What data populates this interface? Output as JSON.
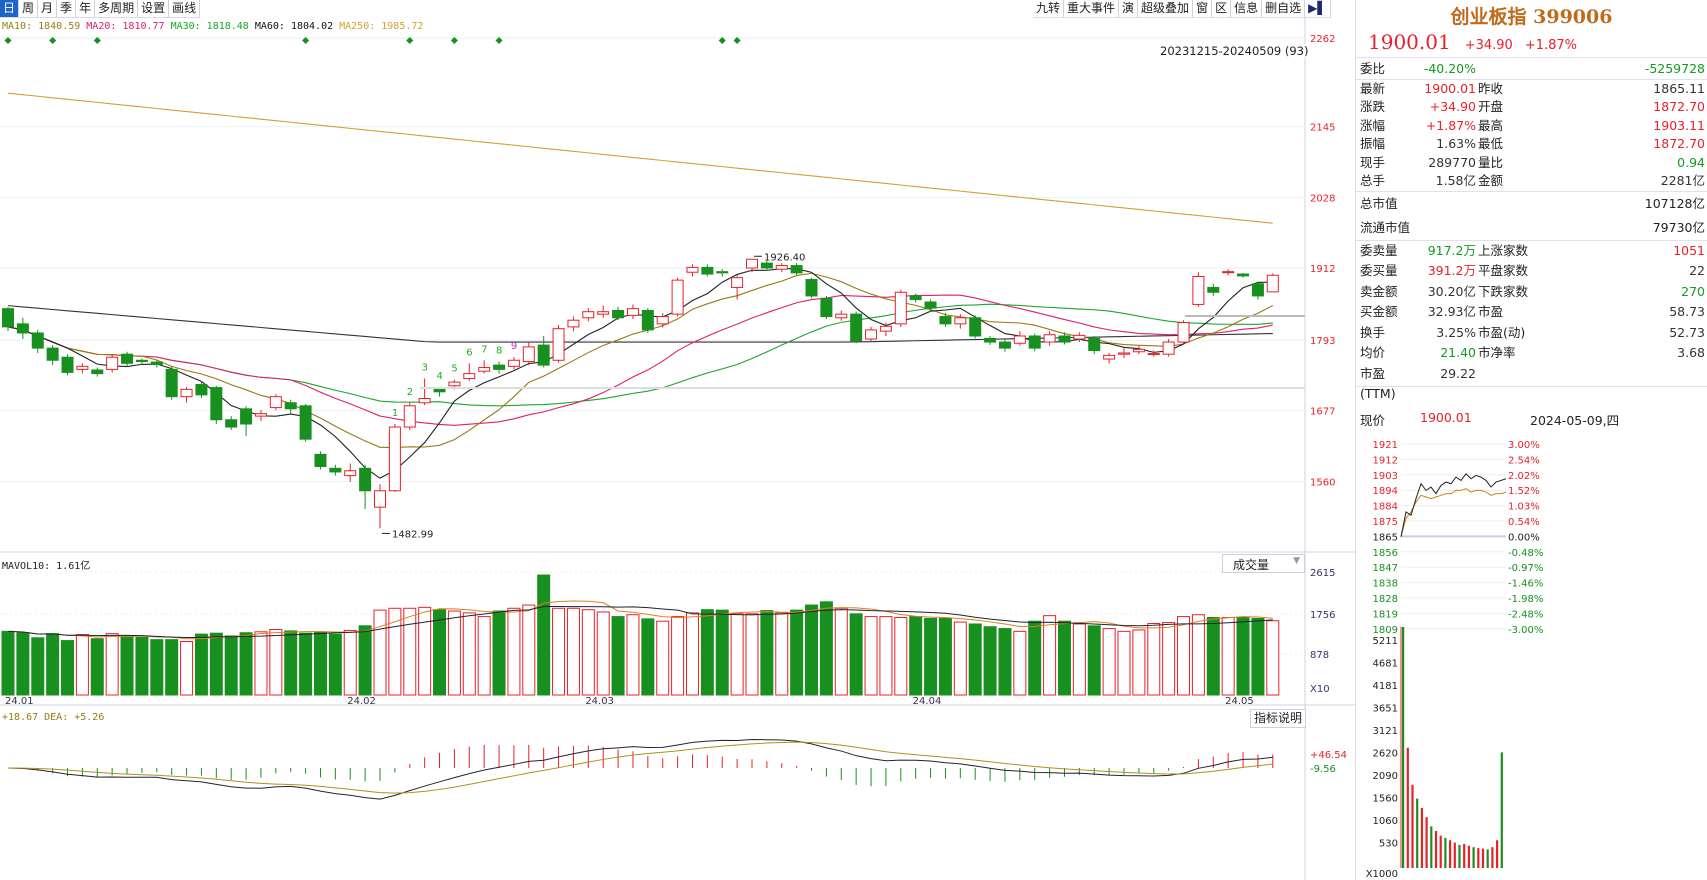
{
  "toolbar_left": [
    "日",
    "周",
    "月",
    "季",
    "年",
    "多周期",
    "设置",
    "画线"
  ],
  "toolbar_right": [
    "九转",
    "重大事件",
    "演",
    "超级叠加",
    "窗",
    "区",
    "信息",
    "删自选"
  ],
  "ma_legend": [
    {
      "t": "MA10: 1840.59",
      "c": "#9a7a14"
    },
    {
      "t": "MA20: 1810.77",
      "c": "#e0206a"
    },
    {
      "t": "MA30: 1818.48",
      "c": "#1aa62a"
    },
    {
      "t": "MA60: 1804.02",
      "c": "#111111"
    },
    {
      "t": "MA250: 1985.72",
      "c": "#d4a030"
    }
  ],
  "range_label": "20231215-20240509 (93)",
  "vol_label": "MAVOL10: 1.61亿",
  "vol_select": "成交量",
  "macd_label": "+18.67 DEA: +5.26",
  "macd_btn": "指标说明",
  "chart_data": {
    "type": "candlestick",
    "price_ticks": [
      "2262",
      "2145",
      "2028",
      "1912",
      "1793",
      "1677",
      "1560"
    ],
    "price_tick_values": [
      2262,
      2145,
      2028,
      1912,
      1793,
      1677,
      1560
    ],
    "vol_ticks": [
      "2615",
      "1756",
      "878",
      "X10"
    ],
    "macd_ticks": [
      "+46.54",
      "-9.56"
    ],
    "date_labels": [
      {
        "t": "24.01",
        "i": 0
      },
      {
        "t": "24.02",
        "i": 23
      },
      {
        "t": "24.03",
        "i": 39
      },
      {
        "t": "24.04",
        "i": 61
      },
      {
        "t": "24.05",
        "i": 82
      }
    ],
    "ohlc": [
      [
        1845,
        1815,
        1848,
        1808
      ],
      [
        1820,
        1805,
        1830,
        1795
      ],
      [
        1805,
        1780,
        1810,
        1772
      ],
      [
        1780,
        1760,
        1785,
        1752
      ],
      [
        1765,
        1740,
        1770,
        1735
      ],
      [
        1745,
        1750,
        1755,
        1738
      ],
      [
        1744,
        1738,
        1748,
        1733
      ],
      [
        1745,
        1765,
        1770,
        1740
      ],
      [
        1770,
        1755,
        1774,
        1750
      ],
      [
        1760,
        1758,
        1763,
        1752
      ],
      [
        1757,
        1753,
        1760,
        1748
      ],
      [
        1745,
        1700,
        1750,
        1695
      ],
      [
        1700,
        1712,
        1716,
        1690
      ],
      [
        1720,
        1703,
        1725,
        1698
      ],
      [
        1715,
        1662,
        1718,
        1655
      ],
      [
        1662,
        1650,
        1668,
        1645
      ],
      [
        1680,
        1655,
        1684,
        1635
      ],
      [
        1668,
        1672,
        1678,
        1660
      ],
      [
        1682,
        1700,
        1704,
        1678
      ],
      [
        1690,
        1680,
        1695,
        1672
      ],
      [
        1685,
        1630,
        1688,
        1626
      ],
      [
        1605,
        1585,
        1610,
        1580
      ],
      [
        1582,
        1576,
        1588,
        1570
      ],
      [
        1570,
        1578,
        1590,
        1560
      ],
      [
        1582,
        1545,
        1588,
        1515
      ],
      [
        1518,
        1545,
        1556,
        1482.99
      ],
      [
        1545,
        1650,
        1655,
        1543
      ],
      [
        1650,
        1685,
        1690,
        1645
      ],
      [
        1690,
        1697,
        1730,
        1686
      ],
      [
        1712,
        1708,
        1716,
        1700
      ],
      [
        1718,
        1724,
        1728,
        1712
      ],
      [
        1730,
        1738,
        1755,
        1726
      ],
      [
        1742,
        1748,
        1760,
        1738
      ],
      [
        1752,
        1745,
        1758,
        1738
      ],
      [
        1750,
        1760,
        1765,
        1745
      ],
      [
        1758,
        1782,
        1790,
        1752
      ],
      [
        1785,
        1752,
        1800,
        1748
      ],
      [
        1760,
        1812,
        1818,
        1756
      ],
      [
        1815,
        1826,
        1832,
        1808
      ],
      [
        1830,
        1840,
        1846,
        1824
      ],
      [
        1836,
        1840,
        1850,
        1830
      ],
      [
        1842,
        1830,
        1848,
        1826
      ],
      [
        1834,
        1845,
        1852,
        1828
      ],
      [
        1842,
        1810,
        1846,
        1805
      ],
      [
        1820,
        1832,
        1838,
        1814
      ],
      [
        1836,
        1892,
        1896,
        1832
      ],
      [
        1905,
        1913,
        1918,
        1898
      ],
      [
        1913,
        1902,
        1918,
        1898
      ],
      [
        1906,
        1904,
        1910,
        1898
      ],
      [
        1880,
        1896,
        1900,
        1860
      ],
      [
        1912,
        1926.4,
        1926.4,
        1905
      ],
      [
        1920,
        1912,
        1924,
        1908
      ],
      [
        1910,
        1916,
        1920,
        1905
      ],
      [
        1916,
        1904,
        1920,
        1900
      ],
      [
        1893,
        1866,
        1896,
        1862
      ],
      [
        1862,
        1832,
        1866,
        1828
      ],
      [
        1830,
        1836,
        1842,
        1825
      ],
      [
        1836,
        1792,
        1840,
        1788
      ],
      [
        1795,
        1810,
        1815,
        1790
      ],
      [
        1808,
        1816,
        1822,
        1800
      ],
      [
        1820,
        1872,
        1876,
        1815
      ],
      [
        1866,
        1860,
        1870,
        1855
      ],
      [
        1856,
        1846,
        1860,
        1840
      ],
      [
        1832,
        1820,
        1838,
        1815
      ],
      [
        1820,
        1830,
        1836,
        1812
      ],
      [
        1830,
        1800,
        1834,
        1796
      ],
      [
        1796,
        1790,
        1800,
        1785
      ],
      [
        1790,
        1780,
        1794,
        1774
      ],
      [
        1788,
        1800,
        1808,
        1784
      ],
      [
        1800,
        1780,
        1804,
        1775
      ],
      [
        1790,
        1802,
        1808,
        1784
      ],
      [
        1800,
        1790,
        1806,
        1786
      ],
      [
        1795,
        1801,
        1806,
        1790
      ],
      [
        1796,
        1776,
        1800,
        1770
      ],
      [
        1762,
        1768,
        1772,
        1755
      ],
      [
        1770,
        1772,
        1780,
        1764
      ],
      [
        1774,
        1778,
        1784,
        1770
      ],
      [
        1770,
        1771,
        1776,
        1766
      ],
      [
        1770,
        1790,
        1795,
        1766
      ],
      [
        1790,
        1822,
        1826,
        1786
      ],
      [
        1852,
        1898,
        1905,
        1848
      ],
      [
        1880,
        1872,
        1886,
        1866
      ],
      [
        1905,
        1906,
        1910,
        1900
      ],
      [
        1902,
        1899,
        1904,
        1896
      ],
      [
        1886,
        1866,
        1890,
        1860
      ],
      [
        1872.7,
        1900.01,
        1903.11,
        1872.7
      ]
    ],
    "volume": [
      1380,
      1350,
      1240,
      1330,
      1180,
      1310,
      1220,
      1330,
      1290,
      1250,
      1200,
      1200,
      1160,
      1320,
      1340,
      1280,
      1350,
      1370,
      1420,
      1390,
      1340,
      1360,
      1320,
      1400,
      1500,
      1840,
      1880,
      1880,
      1900,
      1850,
      1820,
      1780,
      1700,
      1820,
      1880,
      1950,
      2600,
      1880,
      1880,
      1850,
      1800,
      1700,
      1740,
      1650,
      1600,
      1700,
      1780,
      1850,
      1840,
      1760,
      1760,
      1830,
      1780,
      1840,
      1950,
      2020,
      1880,
      1760,
      1700,
      1700,
      1680,
      1700,
      1660,
      1660,
      1580,
      1540,
      1480,
      1440,
      1380,
      1600,
      1720,
      1600,
      1540,
      1500,
      1440,
      1380,
      1410,
      1550,
      1570,
      1700,
      1740,
      1680,
      1680,
      1690,
      1660,
      1610
    ],
    "ma60": [
      1850,
      1790,
      1790,
      1804.02
    ],
    "ma250": [
      2200,
      1985.72
    ],
    "annotations": [
      {
        "t": "1482.99",
        "i": 25,
        "p": 1482.99
      },
      {
        "t": "1926.40",
        "i": 50,
        "p": 1926.4
      }
    ],
    "td_numbers": [
      "1",
      "2",
      "3",
      "4",
      "5",
      "6",
      "7",
      "8",
      "9"
    ],
    "signal_marks": [
      0,
      3,
      6,
      20,
      27,
      30,
      33,
      48,
      49
    ]
  },
  "quote": {
    "title": "创业板指 399006",
    "price": "1900.01",
    "change": "+34.90",
    "pct": "+1.87%",
    "weibi": {
      "label": "委比",
      "pct": "-40.20%",
      "val": "-5259728"
    },
    "rows1": [
      [
        "最新",
        "1900.01",
        "red",
        "昨收",
        "1865.11",
        "dk"
      ],
      [
        "涨跌",
        "+34.90",
        "red",
        "开盘",
        "1872.70",
        "red"
      ],
      [
        "涨幅",
        "+1.87%",
        "red",
        "最高",
        "1903.11",
        "red"
      ],
      [
        "振幅",
        "1.63%",
        "dk",
        "最低",
        "1872.70",
        "red"
      ],
      [
        "现手",
        "289770",
        "dk",
        "量比",
        "0.94",
        "green"
      ],
      [
        "总手",
        "1.58亿",
        "dk",
        "金额",
        "2281亿",
        "dk"
      ]
    ],
    "rows2": [
      [
        "总市值",
        "107128亿"
      ],
      [
        "流通市值",
        "79730亿"
      ]
    ],
    "rows3": [
      [
        "委卖量",
        "917.2万",
        "green",
        "上涨家数",
        "1051",
        "red"
      ],
      [
        "委买量",
        "391.2万",
        "red",
        "平盘家数",
        "22",
        "dk"
      ],
      [
        "卖金额",
        "30.20亿",
        "dk",
        "下跌家数",
        "270",
        "green"
      ],
      [
        "买金额",
        "32.93亿",
        "dk",
        "市盈",
        "58.73",
        "dk"
      ],
      [
        "换手",
        "3.25%",
        "dk",
        "市盈(动)",
        "52.73",
        "dk"
      ],
      [
        "均价",
        "21.40",
        "green",
        "市净率",
        "3.68",
        "dk"
      ],
      [
        "市盈(TTM)",
        "29.22",
        "dk",
        "",
        "",
        " dk"
      ]
    ],
    "intraday_label": "现价",
    "intraday_price": "1900.01",
    "intraday_date": "2024-05-09,四",
    "intraday_left_ticks": [
      "1921",
      "1912",
      "1903",
      "1894",
      "1884",
      "1875",
      "1865",
      "1856",
      "1847",
      "1838",
      "1828",
      "1819",
      "1809"
    ],
    "intraday_right_ticks": [
      "3.00%",
      "2.54%",
      "2.02%",
      "1.52%",
      "1.03%",
      "0.54%",
      "0.00%",
      "-0.48%",
      "-0.97%",
      "-1.46%",
      "-1.98%",
      "-2.48%",
      "-3.00%"
    ],
    "intraday_vol_ticks": [
      "5211",
      "4681",
      "4181",
      "3651",
      "3121",
      "2620",
      "2090",
      "1560",
      "1060",
      "530",
      "X1000"
    ],
    "intraday_price_path": [
      1865,
      1880,
      1878,
      1888,
      1897,
      1893,
      1895,
      1891,
      1896,
      1898,
      1897,
      1901,
      1899,
      1903,
      1900,
      1902,
      1901,
      1899,
      1895,
      1898,
      1899,
      1900.01
    ],
    "intraday_avg_path": [
      1865,
      1876,
      1880,
      1886,
      1890,
      1889,
      1888,
      1889,
      1890,
      1891,
      1891,
      1893,
      1893,
      1894,
      1892,
      1893,
      1893,
      1892,
      1890,
      1891,
      1891,
      1892
    ],
    "intraday_volume": [
      5211,
      2600,
      1800,
      1500,
      1300,
      1100,
      900,
      800,
      700,
      650,
      600,
      550,
      500,
      520,
      480,
      450,
      430,
      420,
      400,
      450,
      600,
      2500
    ]
  },
  "colors": {
    "up": "#e8202a",
    "down": "#189020",
    "brand": "#c06a1c"
  }
}
